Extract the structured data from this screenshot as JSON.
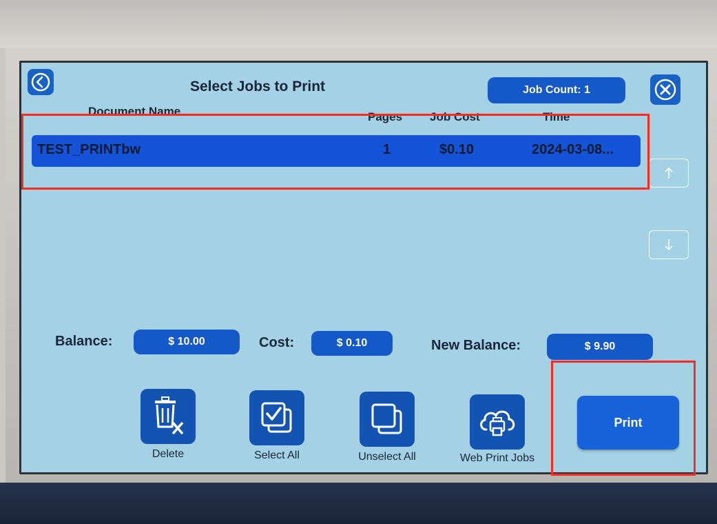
{
  "header": {
    "title": "Select Jobs to Print",
    "job_count": "Job Count: 1"
  },
  "table": {
    "columns": [
      "Document Name",
      "Pages",
      "Job Cost",
      "Time"
    ],
    "rows": [
      {
        "name": "TEST_PRINTbw",
        "pages": "1",
        "cost": "$0.10",
        "time": "2024-03-08..."
      }
    ]
  },
  "summary": {
    "balance_label": "Balance:",
    "balance_value": "$ 10.00",
    "cost_label": "Cost:",
    "cost_value": "$ 0.10",
    "new_balance_label": "New Balance:",
    "new_balance_value": "$ 9.90"
  },
  "toolbar": {
    "delete_label": "Delete",
    "select_all_label": "Select All",
    "unselect_all_label": "Unselect All",
    "web_print_label": "Web Print Jobs",
    "print_label": "Print"
  },
  "icons": {
    "back": "back-arrow-icon",
    "close": "close-icon",
    "scroll_up": "arrow-up-icon",
    "scroll_down": "arrow-down-icon",
    "delete": "trash-icon",
    "select_all": "checkbox-icon",
    "unselect_all": "squares-icon",
    "web_print": "cloud-printer-icon"
  },
  "colors": {
    "screen_bg": "#a4d2e4",
    "accent": "#1558c8",
    "selected_row": "#1554d9",
    "highlight": "#ff2a1f"
  }
}
